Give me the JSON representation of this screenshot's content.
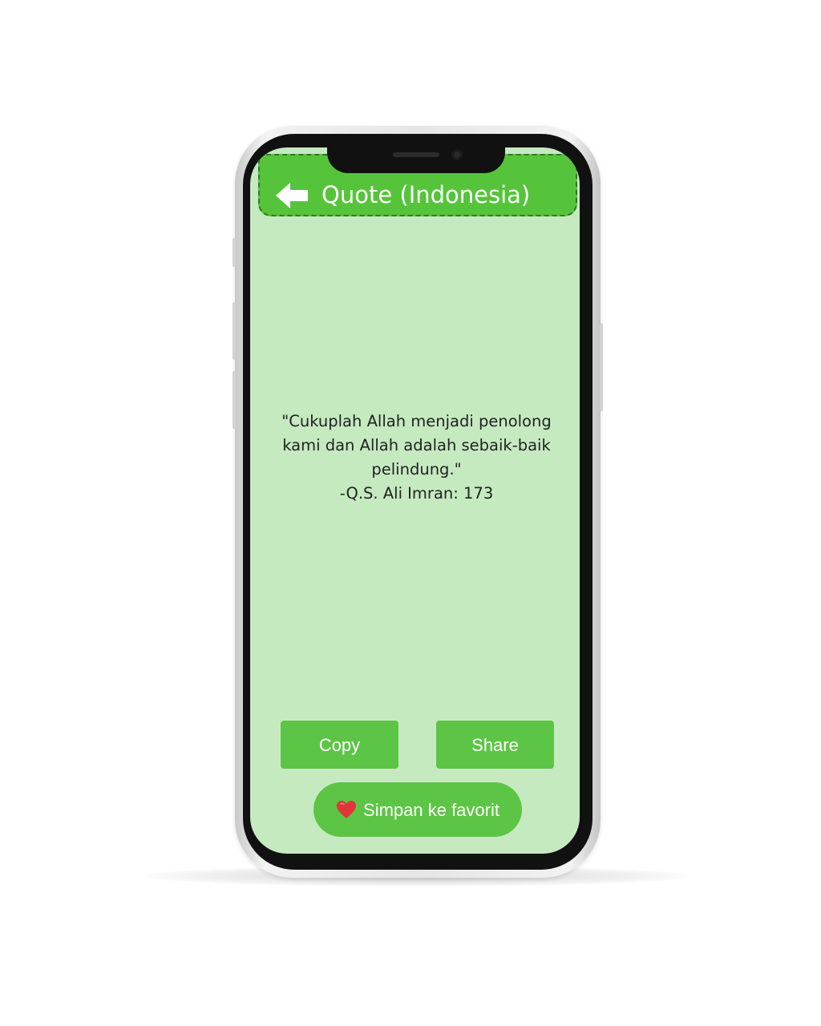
{
  "app_bar": {
    "title": "Quote (Indonesia)",
    "back_icon": "arrow-left-icon"
  },
  "quote": {
    "text": "\"Cukuplah Allah menjadi penolong kami dan Allah adalah sebaik-baik pelindung.\"",
    "source": "-Q.S. Ali Imran: 173"
  },
  "actions": {
    "copy_label": "Copy",
    "share_label": "Share",
    "favorite_label": "Simpan ke favorit",
    "favorite_icon": "heart-icon"
  },
  "colors": {
    "appbar": "#55c43a",
    "screen_background": "#c5eac0",
    "button": "#5dc545",
    "heart": "#e0353b"
  }
}
